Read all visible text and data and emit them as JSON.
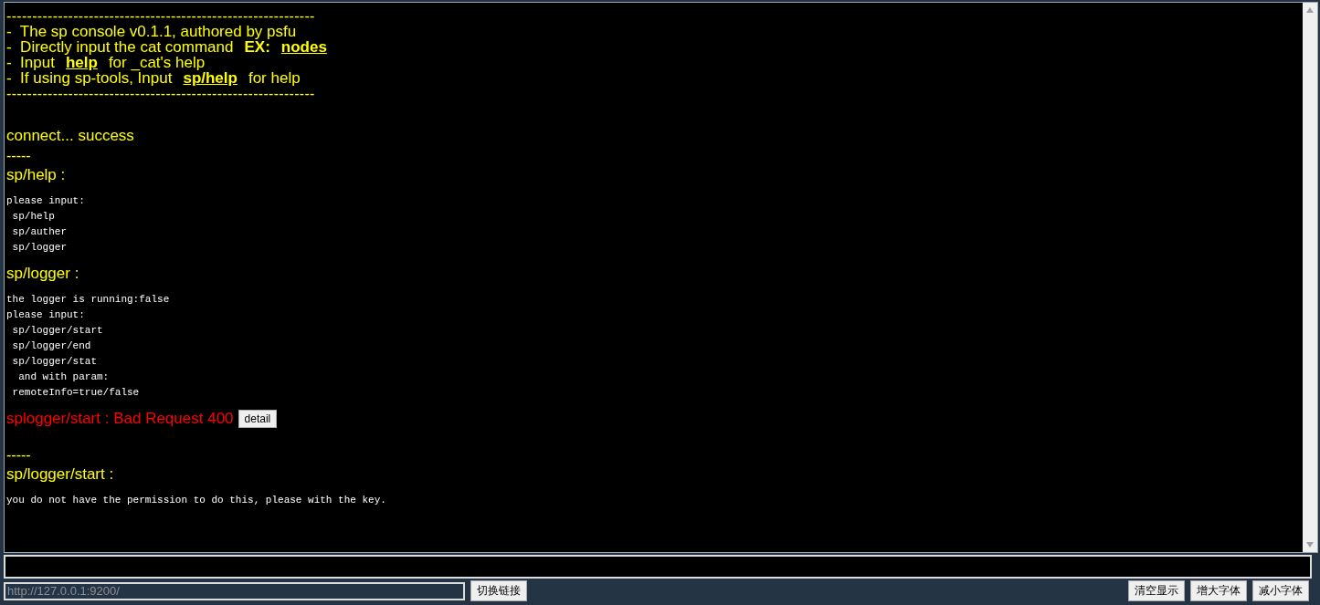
{
  "console": {
    "blocks": [
      {
        "kind": "rule",
        "text": "------------------------------------------------------------"
      },
      {
        "kind": "banner",
        "parts": [
          {
            "kind": "plain",
            "text": "-  The sp console v0.1.1, authored by psfu"
          }
        ]
      },
      {
        "kind": "banner",
        "parts": [
          {
            "kind": "plain",
            "text": "-  Directly input the cat command"
          },
          {
            "kind": "bold",
            "text": "EX:"
          },
          {
            "kind": "link",
            "text": "nodes"
          }
        ]
      },
      {
        "kind": "banner",
        "parts": [
          {
            "kind": "plain",
            "text": "-  Input"
          },
          {
            "kind": "link",
            "text": "help"
          },
          {
            "kind": "plain",
            "text": "for _cat's help"
          }
        ]
      },
      {
        "kind": "banner",
        "parts": [
          {
            "kind": "plain",
            "text": "-  If using sp-tools, Input"
          },
          {
            "kind": "link",
            "text": "sp/help"
          },
          {
            "kind": "plain",
            "text": "for help"
          }
        ]
      },
      {
        "kind": "rule",
        "text": "------------------------------------------------------------"
      },
      {
        "kind": "status",
        "text": "connect... success"
      },
      {
        "kind": "separator",
        "text": "-----"
      },
      {
        "kind": "heading",
        "text": "sp/help :"
      },
      {
        "kind": "output",
        "lines": [
          "please input:",
          " sp/help",
          " sp/auther",
          " sp/logger"
        ]
      },
      {
        "kind": "heading",
        "text": "sp/logger :"
      },
      {
        "kind": "output",
        "lines": [
          "the logger is running:false",
          "please input:",
          " sp/logger/start",
          " sp/logger/end",
          " sp/logger/stat",
          "  and with param:",
          " remoteInfo=true/false"
        ]
      },
      {
        "kind": "error",
        "text": "splogger/start : Bad Request 400",
        "button": "detail"
      },
      {
        "kind": "separator",
        "text": "-----"
      },
      {
        "kind": "heading",
        "text": "sp/logger/start :"
      },
      {
        "kind": "output",
        "lines": [
          "you do not have the permission to do this, please with the key."
        ]
      }
    ]
  },
  "url_field": {
    "value": "http://127.0.0.1:9200/"
  },
  "switch_button": "切换链接",
  "buttons": [
    "清空显示",
    "增大字体",
    "减小字体"
  ]
}
